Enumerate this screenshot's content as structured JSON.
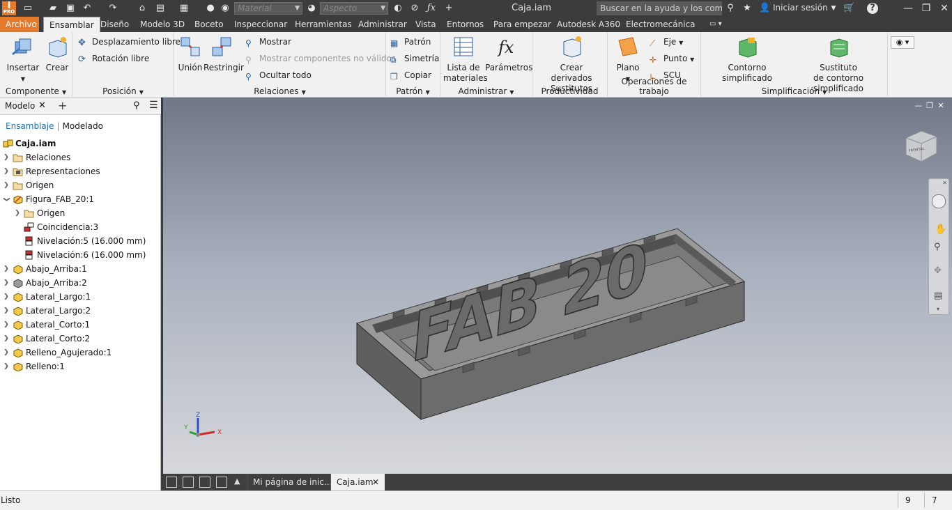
{
  "titlebar": {
    "logo_text": "PRO",
    "material_placeholder": "Material",
    "appearance_placeholder": "Aspecto",
    "doc_title": "Caja.iam",
    "help_search": "Buscar en la ayuda y los comandos",
    "signin": "Iniciar sesión"
  },
  "tabs": [
    "Archivo",
    "Ensamblar",
    "Diseño",
    "Modelo 3D",
    "Boceto",
    "Inspeccionar",
    "Herramientas",
    "Administrar",
    "Vista",
    "Entornos",
    "Para empezar",
    "Autodesk A360",
    "Electromecánica"
  ],
  "ribbon": {
    "componente": {
      "title": "Componente",
      "insertar": "Insertar",
      "crear": "Crear"
    },
    "posicion": {
      "title": "Posición",
      "desplazamiento": "Desplazamiento libre",
      "rotacion": "Rotación libre"
    },
    "relaciones": {
      "title": "Relaciones",
      "union": "Unión",
      "restringir": "Restringir",
      "mostrar": "Mostrar",
      "mostrar_no_validos": "Mostrar componentes no válidos",
      "ocultar_todo": "Ocultar todo"
    },
    "patron": {
      "title": "Patrón",
      "patron": "Patrón",
      "simetria": "Simetría",
      "copiar": "Copiar"
    },
    "administrar": {
      "title": "Administrar",
      "lista1": "Lista de",
      "lista2": "materiales",
      "parametros": "Parámetros"
    },
    "productividad": {
      "title": "Productividad",
      "crear1": "Crear derivados",
      "crear2": "Sustitutos"
    },
    "operaciones": {
      "title": "Operaciones de trabajo",
      "plano": "Plano",
      "eje": "Eje",
      "punto": "Punto",
      "scu": "SCU"
    },
    "simplificacion": {
      "title": "Simplificación",
      "contorno": "Contorno simplificado",
      "sustituto1": "Sustituto",
      "sustituto2": "de contorno simplificado"
    }
  },
  "browser": {
    "title": "Modelo",
    "sub_active": "Ensamblaje",
    "sub_other": "Modelado",
    "root": "Caja.iam",
    "items": [
      {
        "label": "Relaciones",
        "icon": "folder-icon"
      },
      {
        "label": "Representaciones",
        "icon": "representations-icon"
      },
      {
        "label": "Origen",
        "icon": "folder-icon"
      },
      {
        "label": "Figura_FAB_20:1",
        "icon": "part-icon"
      },
      {
        "label": "Origen",
        "icon": "folder-icon"
      },
      {
        "label": "Coincidencia:3",
        "icon": "constraint-icon"
      },
      {
        "label": "Nivelación:5 (16.000 mm)",
        "icon": "flush-icon"
      },
      {
        "label": "Nivelación:6 (16.000 mm)",
        "icon": "flush-icon"
      },
      {
        "label": "Abajo_Arriba:1",
        "icon": "part-icon"
      },
      {
        "label": "Abajo_Arriba:2",
        "icon": "part-gray-icon"
      },
      {
        "label": "Lateral_Largo:1",
        "icon": "part-icon"
      },
      {
        "label": "Lateral_Largo:2",
        "icon": "part-icon"
      },
      {
        "label": "Lateral_Corto:1",
        "icon": "part-icon"
      },
      {
        "label": "Lateral_Corto:2",
        "icon": "part-icon"
      },
      {
        "label": "Relleno_Agujerado:1",
        "icon": "part-icon"
      },
      {
        "label": "Relleno:1",
        "icon": "part-icon"
      }
    ]
  },
  "viewport": {
    "model_text": "FAB 20",
    "triad": {
      "x": "X",
      "y": "Y",
      "z": "Z"
    }
  },
  "doctabs": {
    "home": "Mi página de inic...",
    "active": "Caja.iam"
  },
  "status": {
    "text": "Listo",
    "count1": "9",
    "count2": "7"
  },
  "colors": {
    "accent": "#e57a2a",
    "chrome": "#3c3c3c",
    "ribbon": "#f1f1f1"
  }
}
